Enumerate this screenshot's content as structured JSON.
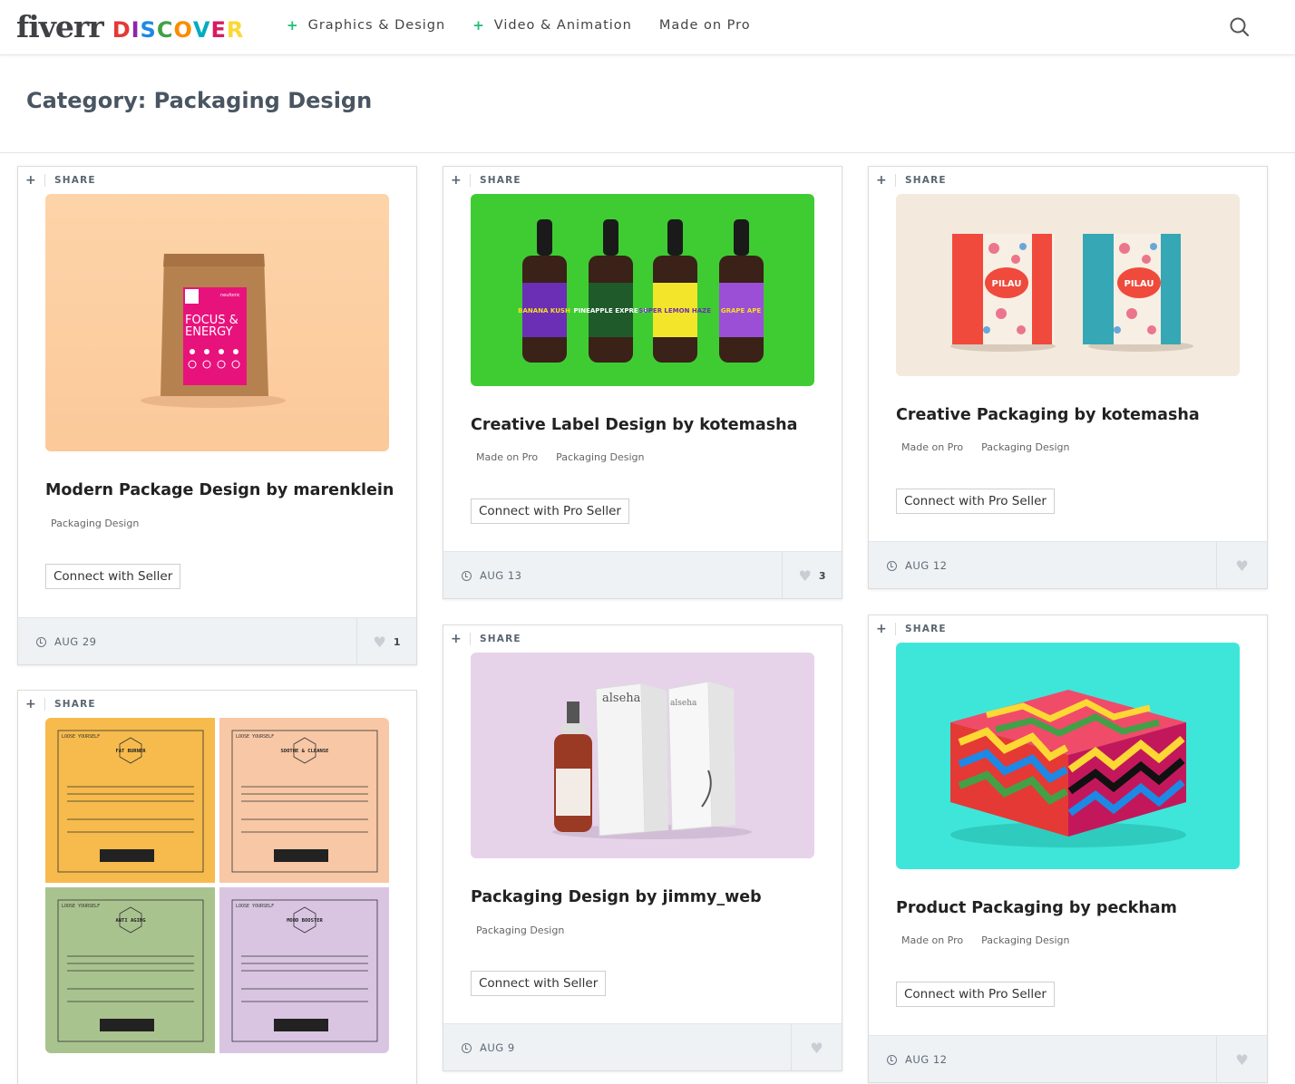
{
  "header": {
    "logo_main": "fiverr",
    "logo_sub": [
      "D",
      "I",
      "S",
      "C",
      "O",
      "V",
      "E",
      "R"
    ],
    "logo_sub_colors": [
      "#e53935",
      "#8e24aa",
      "#1e88e5",
      "#43a047",
      "#fb8c00",
      "#00acc1",
      "#d81b60",
      "#fdd835"
    ],
    "nav": [
      {
        "label": "Graphics & Design",
        "has_plus": true
      },
      {
        "label": "Video & Animation",
        "has_plus": true
      },
      {
        "label": "Made on Pro",
        "has_plus": false
      }
    ],
    "search_icon": "search-icon"
  },
  "category": {
    "title": "Category: Packaging Design"
  },
  "share_label": "SHARE",
  "cards": [
    {
      "title": "Modern Package Design by marenklein",
      "tags": [
        "Packaging Design"
      ],
      "button": "Connect with Seller",
      "date": "AUG 29",
      "likes": "1"
    },
    {
      "title": "",
      "tags": [],
      "button": "",
      "date": "",
      "likes": ""
    },
    {
      "title": "Creative Label Design by kotemasha",
      "tags": [
        "Made on Pro",
        "Packaging Design"
      ],
      "button": "Connect with Pro Seller",
      "date": "AUG 13",
      "likes": "3"
    },
    {
      "title": "Packaging Design by jimmy_web",
      "tags": [
        "Packaging Design"
      ],
      "button": "Connect with Seller",
      "date": "AUG 9",
      "likes": ""
    },
    {
      "title": "Creative Packaging by kotemasha",
      "tags": [
        "Made on Pro",
        "Packaging Design"
      ],
      "button": "Connect with Pro Seller",
      "date": "AUG 12",
      "likes": ""
    },
    {
      "title": "Product Packaging by peckham",
      "tags": [
        "Made on Pro",
        "Packaging Design"
      ],
      "button": "Connect with Pro Seller",
      "date": "AUG 12",
      "likes": ""
    }
  ],
  "images": {
    "pouch": {
      "brand": "neufonic",
      "line1": "FOCUS &",
      "line2": "ENERGY"
    },
    "bottles": [
      "BANANA KUSH",
      "PINEAPPLE EXPRESS",
      "SUPER LEMON HAZE",
      "GRAPE APE"
    ],
    "pilau": "PILAU",
    "alseha": "alseha",
    "tea": [
      {
        "brand": "LOOSE YOURSELF",
        "name": "FAT BURNER"
      },
      {
        "brand": "LOOSE YOURSELF",
        "name": "SOOTHE & CLEANSE"
      },
      {
        "brand": "LOOSE YOURSELF",
        "name": "ANTI AGING"
      },
      {
        "brand": "LOOSE YOURSELF",
        "name": "MOOD BOOSTER"
      }
    ]
  }
}
